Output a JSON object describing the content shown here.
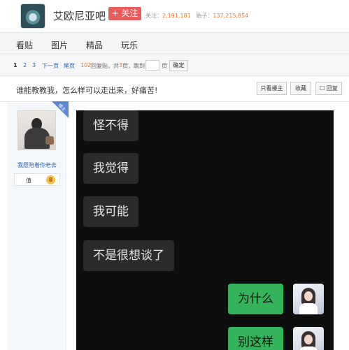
{
  "header": {
    "forum_name": "艾欧尼亚吧",
    "follow_label": "+ 关注",
    "follow_count_label": "关注：",
    "follow_count": "2,191,181",
    "post_count_label": "贴子：",
    "post_count": "137,215,854"
  },
  "nav": {
    "items": [
      "看贴",
      "图片",
      "精品",
      "玩乐"
    ]
  },
  "pager": {
    "pages": [
      "1",
      "2",
      "3"
    ],
    "next_label": "下一页",
    "last_label": "尾页",
    "reply_count": "102",
    "reply_text": "回复贴，共",
    "page_total": "3",
    "page_unit": "页，",
    "jump_label": "跳到",
    "page_suffix": "页",
    "confirm_label": "确定"
  },
  "thread": {
    "title": "谁能教教我，怎么样可以走出来，好痛苦!",
    "only_op_label": "只看楼主",
    "favorite_label": "收藏",
    "reply_label": "回复"
  },
  "author": {
    "badge": "楼主",
    "username": "我愿陪着你老去",
    "level_name": "值",
    "level_number": "8"
  },
  "chat": {
    "left_messages": [
      "怪不得",
      "我觉得",
      "我可能",
      "不是很想谈了"
    ],
    "right_messages": [
      "为什么",
      "别这样"
    ],
    "left_bubble_color": "#2b2b2b",
    "right_bubble_color": "#33b35a"
  },
  "colors": {
    "accent_red": "#ea5b5b",
    "link_blue": "#2d64b3",
    "count_orange": "#ef7c2a"
  }
}
